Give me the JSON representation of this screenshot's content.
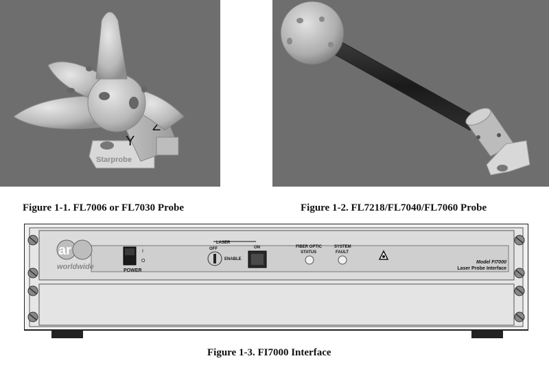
{
  "figures": [
    {
      "caption": "Figure 1-1.  FL7006 or FL7030 Probe",
      "image": {
        "axis_labels": [
          "Y",
          "Z"
        ],
        "brand_text": "Starprobe"
      }
    },
    {
      "caption": "Figure 1-2.  FL7218/FL7040/FL7060 Probe"
    },
    {
      "caption": "Figure 1-3.  FI7000 Interface",
      "panel": {
        "logo_text": "worldwide",
        "power_label": "POWER",
        "switch_on": "I",
        "switch_off": "O",
        "laser_title": "LASER",
        "laser_off": "OFF",
        "laser_enable": "ENABLE",
        "laser_on": "ON",
        "fiber_optic_status": [
          "FIBER OPTIC",
          "STATUS"
        ],
        "system_fault": [
          "SYSTEM",
          "FAULT"
        ],
        "model_line1": "Model FI7000",
        "model_line2": "Laser Probe Interface"
      }
    }
  ],
  "colors": {
    "render_bg": "#6f6f6f",
    "probe_body": "#c9c9c9",
    "panel_face": "#d9d9d9"
  }
}
